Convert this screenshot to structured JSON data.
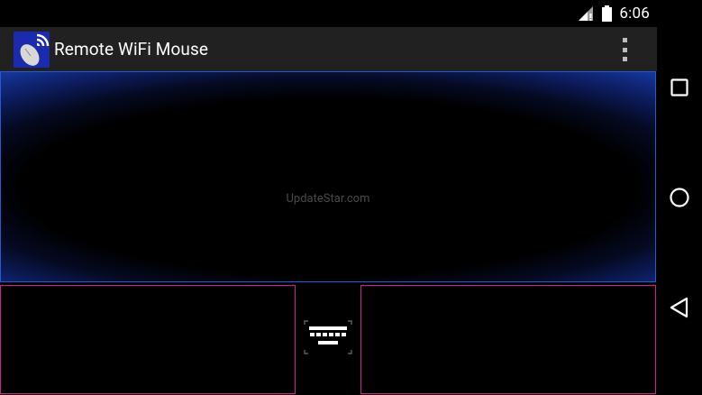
{
  "status_bar": {
    "time": "6:06",
    "icons": [
      "signal-icon",
      "battery-icon"
    ]
  },
  "action_bar": {
    "title": "Remote WiFi Mouse",
    "logo_icon": "wifi-mouse-logo-icon",
    "overflow_icon": "more-vert-icon"
  },
  "touchpad": {
    "watermark": "UpdateStar.com"
  },
  "controls": {
    "left_button_icon": "none",
    "right_button_icon": "none",
    "keyboard_icon": "keyboard-icon"
  },
  "nav_bar": {
    "recents_icon": "square-icon",
    "home_icon": "circle-icon",
    "back_icon": "triangle-back-icon"
  },
  "colors": {
    "action_bar_bg": "#212121",
    "touchpad_glow": "#153597",
    "touchpad_border": "#2a58d6",
    "button_border": "#d0228f"
  }
}
